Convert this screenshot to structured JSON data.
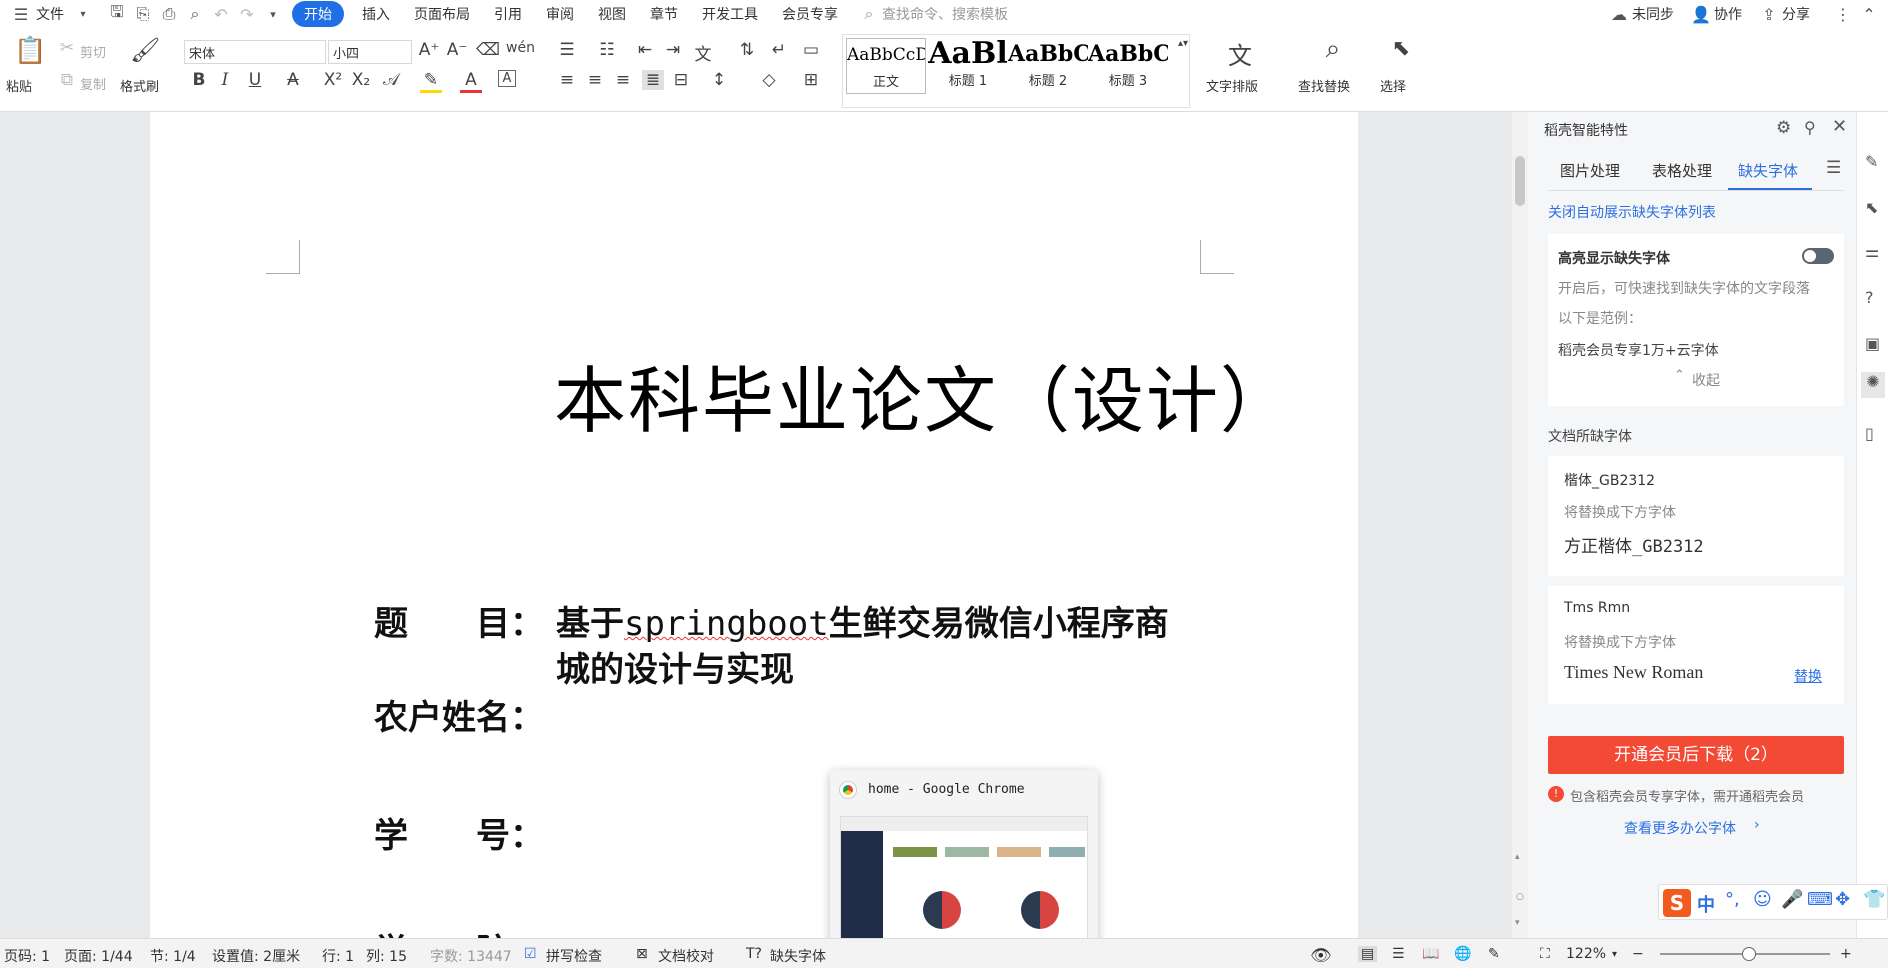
{
  "menubar": {
    "file": "文件",
    "tabs": [
      "开始",
      "插入",
      "页面布局",
      "引用",
      "审阅",
      "视图",
      "章节",
      "开发工具",
      "会员专享"
    ],
    "active_tab": "开始",
    "search_placeholder": "查找命令、搜索模板",
    "unsynced": "未同步",
    "collab": "协作",
    "share": "分享"
  },
  "toolbar": {
    "paste": "粘贴",
    "cut": "剪切",
    "copy": "复制",
    "format_painter": "格式刷",
    "font": "宋体",
    "size": "小四",
    "styles": [
      {
        "preview": "AaBbCcDd",
        "label": "正文"
      },
      {
        "preview": "AaBl",
        "label": "标题 1"
      },
      {
        "preview": "AaBbC",
        "label": "标题 2"
      },
      {
        "preview": "AaBbC",
        "label": "标题 3"
      }
    ],
    "text_layout": "文字排版",
    "find_replace": "查找替换",
    "select": "选择"
  },
  "document": {
    "title": "本科毕业论文（设计）",
    "topic_label": "题　　目：",
    "topic_pre": "基于",
    "topic_code": "springboot",
    "topic_post": "生鲜交易微信小程序商",
    "topic_line2": "城的设计与实现",
    "name_label": "农户姓名：",
    "id_label": "学　　号：",
    "college_label": "学　　院："
  },
  "panel": {
    "header": "稻壳智能特性",
    "tabs": [
      "图片处理",
      "表格处理",
      "缺失字体"
    ],
    "active_tab": "缺失字体",
    "close_auto": "关闭自动展示缺失字体列表",
    "highlight_title": "高亮显示缺失字体",
    "highlight_desc": "开启后，可快速找到缺失字体的文字段落",
    "example_label": "以下是范例：",
    "example_text": "稻壳会员专享1万+云字体",
    "collapse": "收起",
    "missing_title": "文档所缺字体",
    "fonts": [
      {
        "name": "楷体_GB2312",
        "hint": "将替换成下方字体",
        "replacement": "方正楷体_GB2312",
        "action": ""
      },
      {
        "name": "Tms Rmn",
        "hint": "将替换成下方字体",
        "replacement": "Times New Roman",
        "action": "替换"
      }
    ],
    "download_btn": "开通会员后下载（2）",
    "member_note": "包含稻壳会员专享字体，需开通稻壳会员",
    "more_fonts": "查看更多办公字体"
  },
  "popup": {
    "title": "home - Google Chrome"
  },
  "ime": {
    "lang": "中"
  },
  "statusbar": {
    "page_code": "页码: 1",
    "page": "页面: 1/44",
    "section": "节: 1/4",
    "setting": "设置值: 2厘米",
    "row": "行: 1",
    "col": "列: 15",
    "words": "字数: 13447",
    "spell": "拼写检查",
    "proof": "文档校对",
    "missing_font": "缺失字体",
    "zoom": "122%"
  },
  "colors": {
    "accent": "#1f6fe6",
    "download": "#f24a35",
    "link": "#2d6fe0"
  }
}
